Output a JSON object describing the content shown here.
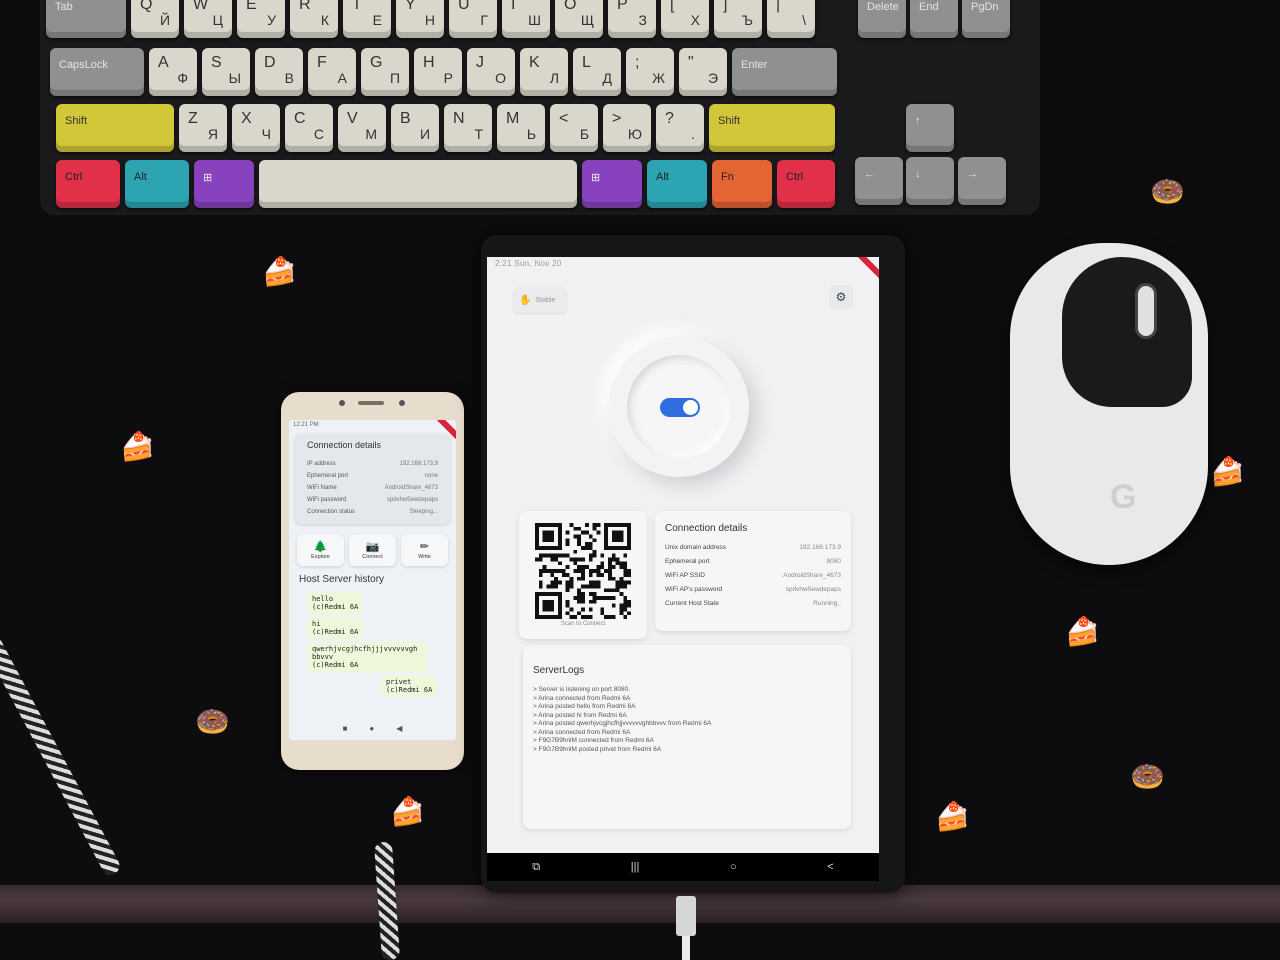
{
  "keyboard": {
    "row1": [
      {
        "main": "Tab",
        "alt": "",
        "w": 1
      },
      {
        "main": "Q",
        "alt": "Й"
      },
      {
        "main": "W",
        "alt": "Ц"
      },
      {
        "main": "E",
        "alt": "У"
      },
      {
        "main": "R",
        "alt": "К"
      },
      {
        "main": "T",
        "alt": "Е"
      },
      {
        "main": "Y",
        "alt": "Н"
      },
      {
        "main": "U",
        "alt": "Г"
      },
      {
        "main": "I",
        "alt": "Ш"
      },
      {
        "main": "O",
        "alt": "Щ"
      },
      {
        "main": "P",
        "alt": "З"
      },
      {
        "main": "[",
        "alt": "Х"
      },
      {
        "main": "]",
        "alt": "Ъ"
      },
      {
        "main": "|",
        "alt": "\\"
      }
    ],
    "row2": [
      {
        "main": "CapsLock",
        "alt": ""
      },
      {
        "main": "A",
        "alt": "Ф"
      },
      {
        "main": "S",
        "alt": "Ы"
      },
      {
        "main": "D",
        "alt": "В"
      },
      {
        "main": "F",
        "alt": "А"
      },
      {
        "main": "G",
        "alt": "П"
      },
      {
        "main": "H",
        "alt": "Р"
      },
      {
        "main": "J",
        "alt": "О"
      },
      {
        "main": "K",
        "alt": "Л"
      },
      {
        "main": "L",
        "alt": "Д"
      },
      {
        "main": ";",
        "alt": "Ж"
      },
      {
        "main": "\"",
        "alt": "Э"
      },
      {
        "main": "Enter",
        "alt": ""
      }
    ],
    "row3": [
      {
        "main": "Shift",
        "alt": ""
      },
      {
        "main": "Z",
        "alt": "Я"
      },
      {
        "main": "X",
        "alt": "Ч"
      },
      {
        "main": "C",
        "alt": "С"
      },
      {
        "main": "V",
        "alt": "М"
      },
      {
        "main": "B",
        "alt": "И"
      },
      {
        "main": "N",
        "alt": "Т"
      },
      {
        "main": "M",
        "alt": "Ь"
      },
      {
        "main": "<",
        "alt": "Б"
      },
      {
        "main": ">",
        "alt": "Ю"
      },
      {
        "main": "?",
        "alt": "."
      },
      {
        "main": "Shift",
        "alt": ""
      }
    ],
    "row4": [
      {
        "main": "Ctrl"
      },
      {
        "main": "Alt"
      },
      {
        "main": "⊞"
      },
      {
        "main": ""
      },
      {
        "main": "⊞"
      },
      {
        "main": "Alt"
      },
      {
        "main": "Fn"
      },
      {
        "main": "Ctrl"
      }
    ],
    "nav": {
      "delete": "Delete",
      "end": "End",
      "pgdn": "PgDn",
      "up": "↑",
      "left": "←",
      "down": "↓",
      "right": "→"
    }
  },
  "phone": {
    "status_time": "12:21 PM",
    "card": {
      "title": "Connection details",
      "rows": [
        {
          "label": "IP address",
          "value": "192.168.173.9"
        },
        {
          "label": "Ephemeral port",
          "value": "none"
        },
        {
          "label": "WiFi Name",
          "value": "AndroidShare_4673"
        },
        {
          "label": "WiFi password",
          "value": "spdvhw5ewdepaps"
        },
        {
          "label": "Connection status",
          "value": "Sleeping..."
        }
      ]
    },
    "actions": [
      {
        "label": "Explore",
        "icon": "tree-icon",
        "glyph": "🌲"
      },
      {
        "label": "Connect",
        "icon": "camera-icon",
        "glyph": "📷"
      },
      {
        "label": "Write",
        "icon": "pen-icon",
        "glyph": "✏"
      }
    ],
    "history_title": "Host Server history",
    "messages": [
      {
        "text": "hello\n(c)Redmi 6A",
        "side": "left"
      },
      {
        "text": "hi\n(c)Redmi 6A",
        "side": "left"
      },
      {
        "text": "qwerhjvcgjhcfhjjjvvvvvvgh bbvvv\n(c)Redmi 6A",
        "side": "left"
      },
      {
        "text": "privet\n(c)Redmi 6A",
        "side": "right"
      }
    ],
    "nav": [
      "■",
      "●",
      "◀"
    ]
  },
  "tablet": {
    "status_bar": "2:21  Sun, Nov 20",
    "badge_label": "Stable",
    "qr_caption": "Scan to Connect",
    "connection": {
      "title": "Connection details",
      "rows": [
        {
          "label": "Unix domain address",
          "value": "192.168.173.9"
        },
        {
          "label": "Ephemeral port",
          "value": "8080"
        },
        {
          "label": "WiFi AP SSID",
          "value": "AndroidShare_4673"
        },
        {
          "label": "WiFi AP's password",
          "value": "spdvhw5ewdepaps"
        },
        {
          "label": "Current Host State",
          "value": "Running.."
        }
      ]
    },
    "logs": {
      "title": "ServerLogs",
      "lines": [
        "> Server is listening on port 8080.",
        "> Arina connected from Redmi 6A",
        "> Arina posted hello from Redmi 6A",
        "> Arina posted hi from Redmi 6A",
        "> Arina posted qwerhjvcgjhcfhjjvvvvvvghbbvvv from Redmi 6A",
        "> Arina connected from Redmi 6A",
        "> F9G7B9hnlM connected from Redmi 6A",
        "> F9G7B9hnlM posted privet from Redmi 6A"
      ]
    },
    "nav": [
      "⧉",
      "|||",
      "○",
      "<"
    ],
    "switch_on": true
  },
  "mouse": {
    "logo": "G"
  }
}
